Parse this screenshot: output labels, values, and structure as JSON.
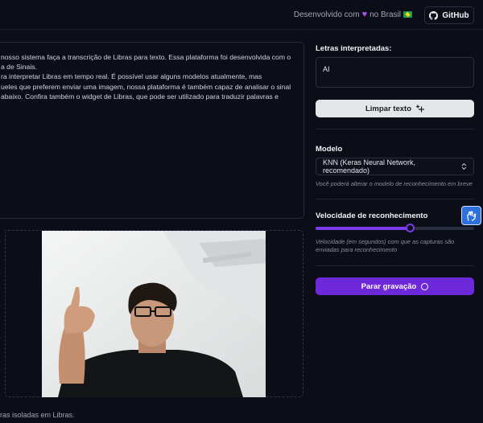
{
  "header": {
    "credit_prefix": "Desenvolvido com",
    "credit_suffix": "no Brasil",
    "github_label": "GitHub"
  },
  "description": {
    "lines": [
      "nosso sistema faça a transcrição de Libras para texto. Essa plataforma foi desenvolvida com o",
      "a de Sinais.",
      "ra interpretar Libras em tempo real. É possível usar alguns modelos atualmente, mas",
      "ueles que preferem enviar uma imagem, nossa plataforma é também capaz de analisar o sinal",
      "abaixo. Confira também o widget de Libras, que pode ser utilizado para traduzir palavras e"
    ]
  },
  "camera": {
    "caption": "ras isoladas em Libras."
  },
  "letters": {
    "label": "Letras interpretadas:",
    "value": "AI"
  },
  "clear_button": {
    "label": "Limpar texto"
  },
  "model": {
    "label": "Modelo",
    "selected": "KNN (Keras Neural Network, recomendado)",
    "hint": "Você poderá alterar o modelo de reconhecimento em breve"
  },
  "speed": {
    "label": "Velocidade de reconhecimento",
    "value_fraction": 0.6,
    "hint": "Velocidade (em segundos) com que as capturas são enviadas para reconhecimento"
  },
  "record_button": {
    "label": "Parar gravação"
  },
  "colors": {
    "accent": "#6d28d9",
    "background": "#0b0d17",
    "widget": "#2d6fdc"
  }
}
